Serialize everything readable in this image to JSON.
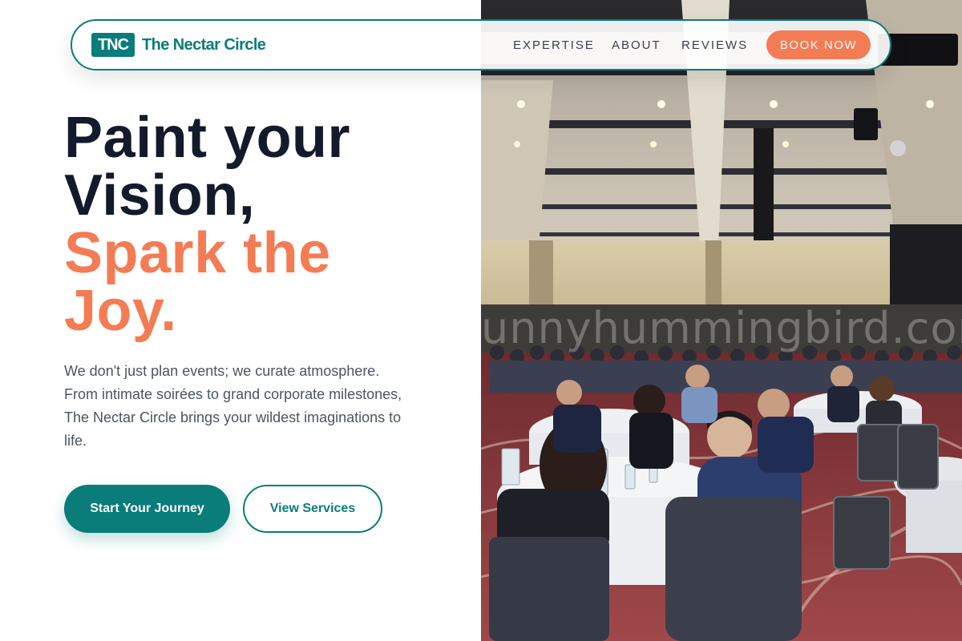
{
  "nav": {
    "logo_mark": "TNC",
    "brand_name": "The Nectar Circle",
    "links": [
      "EXPERTISE",
      "ABOUT",
      "REVIEWS"
    ],
    "cta_label": "BOOK NOW"
  },
  "hero": {
    "headline_line1": "Paint your",
    "headline_line2": "Vision,",
    "headline_accent_line1": "Spark the",
    "headline_accent_line2": "Joy.",
    "subcopy": "We don't just plan events; we curate atmosphere. From intimate soirées to grand corporate milestones, The Nectar Circle brings your wildest imaginations to life.",
    "primary_button": "Start Your Journey",
    "secondary_button": "View Services",
    "image_watermark": "unnyhummingbird.com"
  },
  "colors": {
    "brand_teal": "#0a7c7a",
    "accent_coral": "#f47c54",
    "heading_dark": "#131a2b",
    "body_text": "#4b5563"
  },
  "icons": {
    "hero_image": "ballroom-event-photo"
  }
}
